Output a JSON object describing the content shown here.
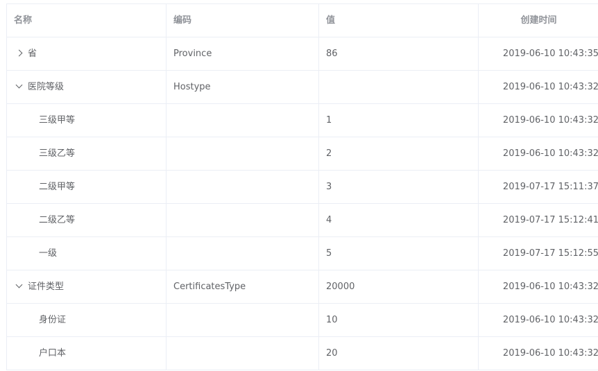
{
  "header": {
    "name": "名称",
    "code": "编码",
    "value": "值",
    "created": "创建时间"
  },
  "rows": [
    {
      "name": "省",
      "code": "Province",
      "value": "86",
      "created": "2019-06-10 10:43:35",
      "expander": "collapsed"
    },
    {
      "name": "医院等级",
      "code": "Hostype",
      "value": "",
      "created": "2019-06-10 10:43:32",
      "expander": "expanded"
    },
    {
      "name": "三级甲等",
      "code": "",
      "value": "1",
      "created": "2019-06-10 10:43:32"
    },
    {
      "name": "三级乙等",
      "code": "",
      "value": "2",
      "created": "2019-06-10 10:43:32"
    },
    {
      "name": "二级甲等",
      "code": "",
      "value": "3",
      "created": "2019-07-17 15:11:37"
    },
    {
      "name": "二级乙等",
      "code": "",
      "value": "4",
      "created": "2019-07-17 15:12:41"
    },
    {
      "name": "一级",
      "code": "",
      "value": "5",
      "created": "2019-07-17 15:12:55"
    },
    {
      "name": "证件类型",
      "code": "CertificatesType",
      "value": "20000",
      "created": "2019-06-10 10:43:32",
      "expander": "expanded"
    },
    {
      "name": "身份证",
      "code": "",
      "value": "10",
      "created": "2019-06-10 10:43:32"
    },
    {
      "name": "户口本",
      "code": "",
      "value": "20",
      "created": "2019-06-10 10:43:32"
    }
  ]
}
